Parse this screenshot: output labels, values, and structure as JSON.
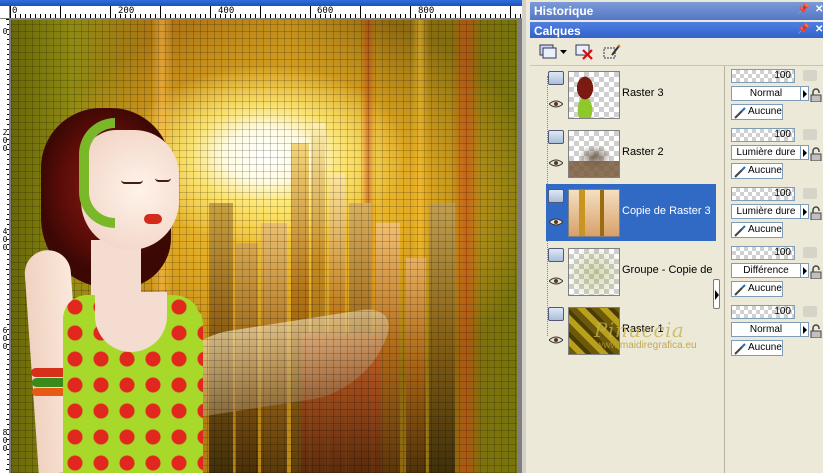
{
  "rulers": {
    "top": [
      "0",
      "200",
      "400",
      "600",
      "800"
    ],
    "left": [
      "0",
      "200",
      "400",
      "600",
      "800"
    ]
  },
  "palettes": {
    "historique": {
      "title": "Historique",
      "icons": [
        "pin-icon",
        "close-icon"
      ]
    },
    "calques": {
      "title": "Calques",
      "icons": [
        "pin-icon",
        "close-icon"
      ]
    }
  },
  "toolbar": {
    "buttons": [
      "new-layer-icon",
      "dropdown-arrow-icon",
      "delete-layer-icon",
      "edit-selection-icon"
    ]
  },
  "layers": [
    {
      "name": "Raster 3",
      "opacity": "100",
      "blend_mode": "Normal",
      "mask": "Aucune",
      "selected": false,
      "thumb": "woman-thumbnail"
    },
    {
      "name": "Raster 2",
      "opacity": "100",
      "blend_mode": "Lumière dure",
      "mask": "Aucune",
      "selected": false,
      "thumb": "city-thumbnail"
    },
    {
      "name": "Copie de Raster 3",
      "opacity": "100",
      "blend_mode": "Lumière dure",
      "mask": "Aucune",
      "selected": true,
      "thumb": "gold-streak-thumbnail"
    },
    {
      "name": "Groupe - Copie de Ras",
      "opacity": "100",
      "blend_mode": "Différence",
      "mask": "Aucune",
      "selected": false,
      "thumb": "group-thumbnail"
    },
    {
      "name": "Raster 1",
      "opacity": "100",
      "blend_mode": "Normal",
      "mask": "Aucune",
      "selected": false,
      "thumb": "pattern-thumbnail"
    }
  ],
  "watermark": {
    "name": "Pinuccia",
    "url": "www.maidiregrafica.eu"
  },
  "colors": {
    "selected": "#316ac5",
    "title_bar": "#2f5fc8",
    "panel_bg": "#ece9d8"
  }
}
